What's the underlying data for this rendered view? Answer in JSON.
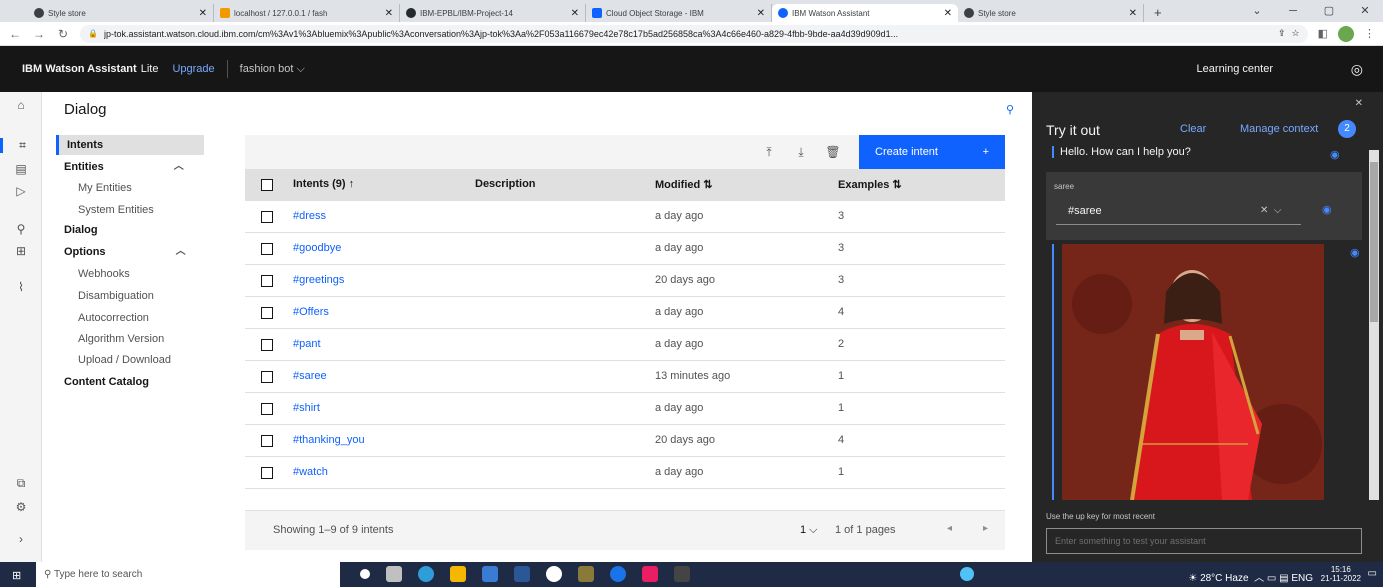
{
  "browser": {
    "tabs": [
      {
        "label": "Style store",
        "color": "#3c4043"
      },
      {
        "label": "localhost / 127.0.0.1 / fash",
        "color": "#f29900"
      },
      {
        "label": "IBM-EPBL/IBM-Project-14",
        "color": "#24292e"
      },
      {
        "label": "Cloud Object Storage - IBM",
        "color": "#0f62fe"
      },
      {
        "label": "IBM Watson Assistant",
        "color": "#0f62fe"
      },
      {
        "label": "Style store",
        "color": "#3c4043"
      }
    ],
    "url": "jp-tok.assistant.watson.cloud.ibm.com/cm%3Av1%3Abluemix%3Apublic%3Aconversation%3Ajp-tok%3Aa%2F053a116679ec42e78c17b5ad256858ca%3A4c66e460-a829-4fbb-9bde-aa4d39d909d1..."
  },
  "header": {
    "brand": "IBM Watson Assistant",
    "plan": "Lite",
    "upgrade": "Upgrade",
    "assistant": "fashion bot",
    "learning_center": "Learning center"
  },
  "page": {
    "title": "Dialog"
  },
  "subnav": {
    "intents": "Intents",
    "entities": "Entities",
    "my_entities": "My Entities",
    "system_entities": "System Entities",
    "dialog": "Dialog",
    "options": "Options",
    "webhooks": "Webhooks",
    "disambiguation": "Disambiguation",
    "autocorrection": "Autocorrection",
    "algorithm_version": "Algorithm Version",
    "upload_download": "Upload / Download",
    "content_catalog": "Content Catalog"
  },
  "toolbar": {
    "create_intent": "Create intent"
  },
  "table": {
    "headers": {
      "name": "Intents (9) ↑",
      "description": "Description",
      "modified": "Modified ⇅",
      "examples": "Examples ⇅"
    },
    "rows": [
      {
        "name": "#dress",
        "modified": "a day ago",
        "examples": "3"
      },
      {
        "name": "#goodbye",
        "modified": "a day ago",
        "examples": "3"
      },
      {
        "name": "#greetings",
        "modified": "20 days ago",
        "examples": "3"
      },
      {
        "name": "#Offers",
        "modified": "a day ago",
        "examples": "4"
      },
      {
        "name": "#pant",
        "modified": "a day ago",
        "examples": "2"
      },
      {
        "name": "#saree",
        "modified": "13 minutes ago",
        "examples": "1"
      },
      {
        "name": "#shirt",
        "modified": "a day ago",
        "examples": "1"
      },
      {
        "name": "#thanking_you",
        "modified": "20 days ago",
        "examples": "4"
      },
      {
        "name": "#watch",
        "modified": "a day ago",
        "examples": "1"
      }
    ]
  },
  "pager": {
    "showing": "Showing 1–9 of 9 intents",
    "page": "1",
    "pages": "1 of 1 pages"
  },
  "tryit": {
    "title": "Try it out",
    "clear": "Clear",
    "manage_context": "Manage context",
    "context_count": "2",
    "bot_message": "Hello. How can I help you?",
    "user_message": "saree",
    "intent_value": "#saree",
    "hint": "Use the up key for most recent",
    "input_placeholder": "Enter something to test your assistant"
  },
  "taskbar": {
    "search_placeholder": "Type here to search",
    "weather": "28°C  Haze",
    "lang": "ENG",
    "time": "15:16",
    "date": "21-11-2022"
  },
  "colors": {
    "accent": "#0f62fe",
    "header_bg": "#161616",
    "panel_bg": "#262626",
    "link": "#78a9ff"
  }
}
